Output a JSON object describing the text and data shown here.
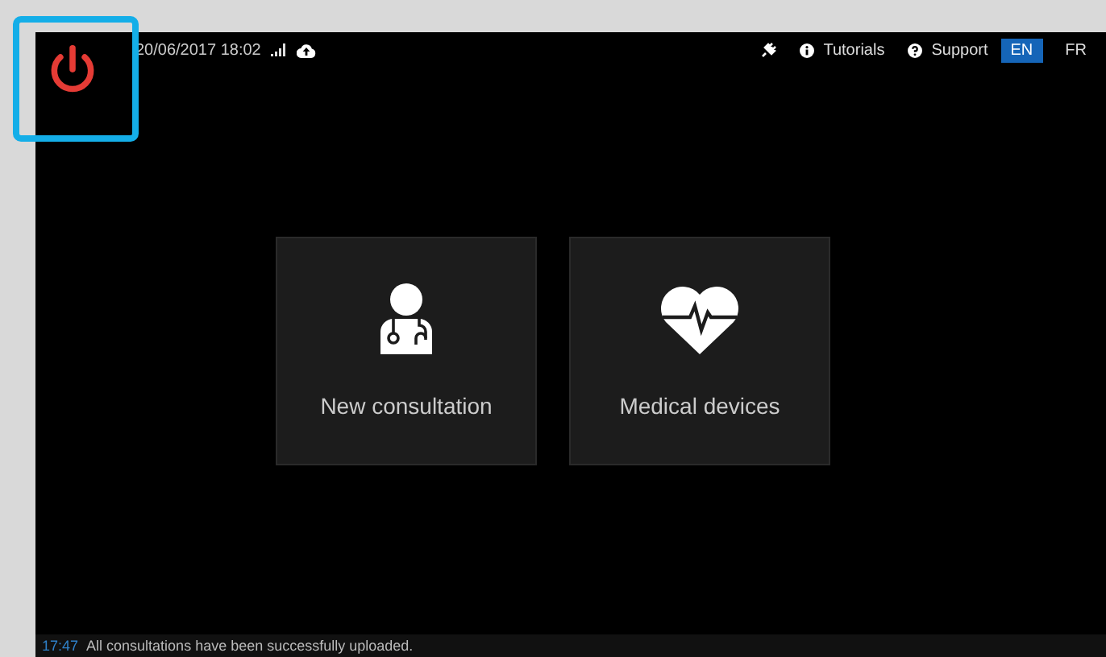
{
  "top_bar": {
    "datetime": "20/06/2017 18:02",
    "links": [
      {
        "label": "Tutorials",
        "kind": "info"
      },
      {
        "label": "Support",
        "kind": "help"
      }
    ],
    "languages": [
      {
        "label": "EN",
        "selected": true
      },
      {
        "label": "FR",
        "selected": false
      }
    ]
  },
  "tiles": [
    {
      "label": "New consultation",
      "kind": "doctor"
    },
    {
      "label": "Medical devices",
      "kind": "heart"
    }
  ],
  "status_bar": {
    "time": "17:47",
    "message": "All consultations have been successfully uploaded."
  }
}
